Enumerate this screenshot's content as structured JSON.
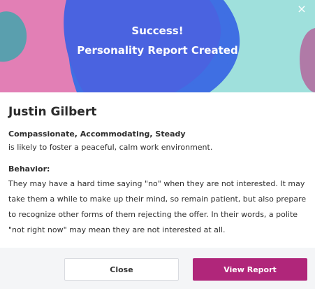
{
  "banner": {
    "title": "Success!",
    "subtitle": "Personality Report Created",
    "close_glyph": "×",
    "colors": {
      "blue": "#3f6fe3",
      "pink": "#e27fb5",
      "teal": "#9fe0dc",
      "mauve": "#b07aa7"
    }
  },
  "profile": {
    "name": "Justin Gilbert",
    "traits": "Compassionate, Accommodating, Steady",
    "summary": "is likely to foster a peaceful, calm work environment.",
    "behavior_label": "Behavior:",
    "behavior_text": "They may have a hard time saying \"no\" when they are not interested. It may take them a while to make up their mind, so remain patient, but also prepare to recognize other forms of them rejecting the offer. In their words, a polite \"not right now\" may mean they are not interested at all."
  },
  "footer": {
    "close_label": "Close",
    "view_label": "View Report",
    "accent": "#b0267a"
  }
}
